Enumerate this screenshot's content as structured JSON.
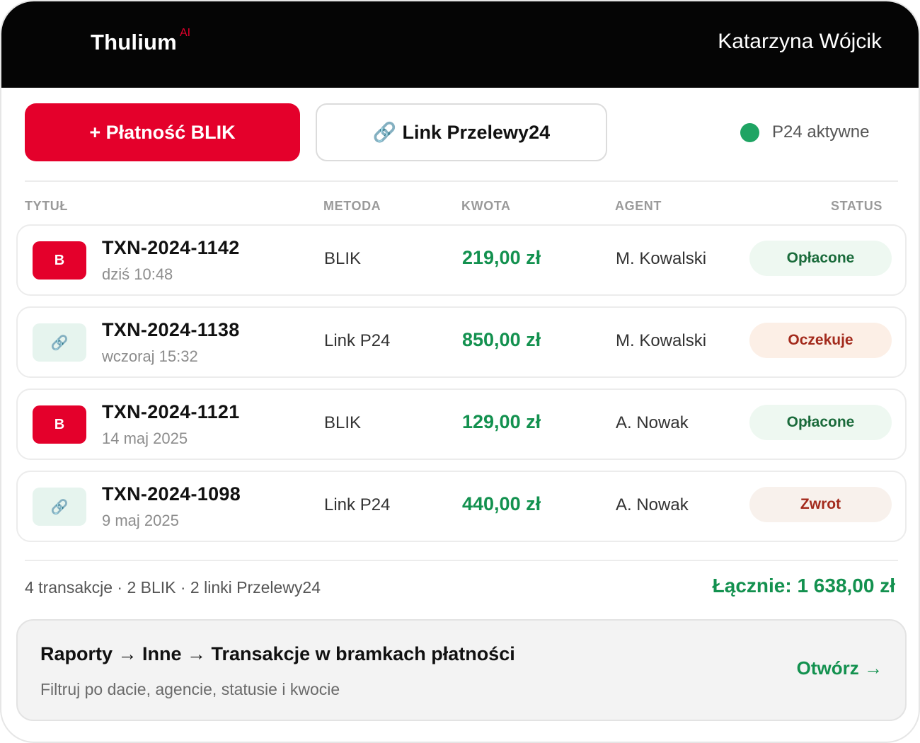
{
  "header": {
    "brand": "Thulium",
    "brand_badge": "AI",
    "user_name": "Katarzyna Wójcik"
  },
  "toolbar": {
    "blik_button": "+ Płatność BLIK",
    "link_button_icon": "🔗",
    "link_button": "Link Przelewy24",
    "p24_status": "P24 aktywne",
    "p24_status_color": "#1fa463"
  },
  "table": {
    "columns": {
      "title": "TYTUŁ",
      "method": "METODA",
      "amount": "KWOTA",
      "agent": "AGENT",
      "status": "STATUS"
    },
    "rows": [
      {
        "icon": "B",
        "icon_name": "blik-icon",
        "id": "TXN-2024-1142",
        "time": "dziś 10:48",
        "method": "BLIK",
        "amount": "219,00 zł",
        "agent": "M. Kowalski",
        "status": "Opłacone",
        "status_type": "paid"
      },
      {
        "icon": "🔗",
        "icon_name": "link-icon",
        "id": "TXN-2024-1138",
        "time": "wczoraj 15:32",
        "method": "Link P24",
        "amount": "850,00 zł",
        "agent": "M. Kowalski",
        "status": "Oczekuje",
        "status_type": "pending"
      },
      {
        "icon": "B",
        "icon_name": "blik-icon",
        "id": "TXN-2024-1121",
        "time": "14 maj 2025",
        "method": "BLIK",
        "amount": "129,00 zł",
        "agent": "A. Nowak",
        "status": "Opłacone",
        "status_type": "paid"
      },
      {
        "icon": "🔗",
        "icon_name": "link-icon",
        "id": "TXN-2024-1098",
        "time": "9 maj 2025",
        "method": "Link P24",
        "amount": "440,00 zł",
        "agent": "A. Nowak",
        "status": "Zwrot",
        "status_type": "refund"
      }
    ]
  },
  "footer": {
    "summary": "4 transakcje · 2 BLIK · 2 linki Przelewy24",
    "total": "Łącznie: 1 638,00 zł"
  },
  "report": {
    "title": "Raporty → Inne → Transakcje w bramkach płatności",
    "subtitle": "Filtruj po dacie, agencie, statusie i kwocie",
    "open": "Otwórz →"
  }
}
